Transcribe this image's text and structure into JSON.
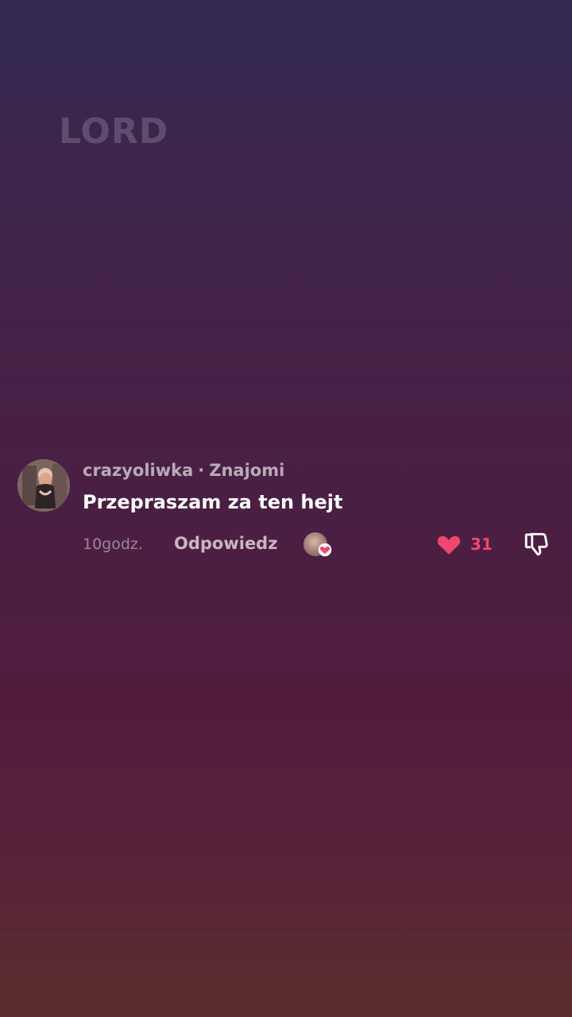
{
  "watermark": {
    "text": "LORD"
  },
  "comment": {
    "username": "crazyoliwka",
    "separator": "·",
    "relation": "Znajomi",
    "text": "Przepraszam za ten hejt",
    "time": "10godz.",
    "reply_label": "Odpowiedz",
    "creator_liked": true,
    "like_count": "31",
    "liked": true
  },
  "colors": {
    "like_accent": "#f0476f",
    "text_primary": "#ffffff",
    "text_secondary": "rgba(255,255,255,0.62)"
  },
  "icons": {
    "avatar": "avatar",
    "creator_like_badge": "heart-icon",
    "like": "heart-icon",
    "dislike": "thumbs-down-icon"
  }
}
